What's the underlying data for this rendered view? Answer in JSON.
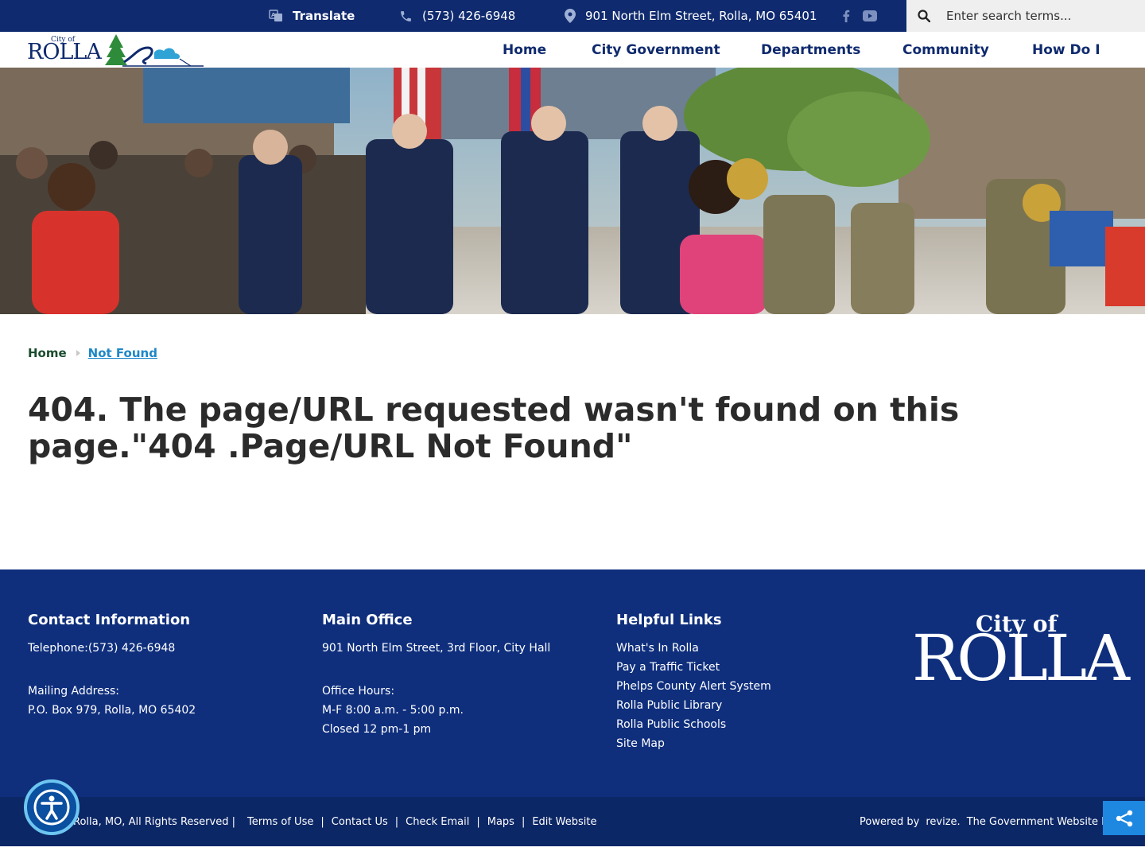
{
  "topbar": {
    "translate_label": "Translate",
    "phone": "(573) 426-6948",
    "address": "901 North Elm Street, Rolla, MO 65401",
    "search_placeholder": "Enter search terms..."
  },
  "logo": {
    "city_of": "City of",
    "name": "ROLLA"
  },
  "nav": {
    "items": [
      {
        "label": "Home"
      },
      {
        "label": "City Government"
      },
      {
        "label": "Departments"
      },
      {
        "label": "Community"
      },
      {
        "label": "How Do I"
      }
    ]
  },
  "breadcrumb": {
    "home": "Home",
    "current": "Not Found"
  },
  "main": {
    "title": "404. The page/URL requested wasn't found on this page.\"404 .Page/URL Not Found\""
  },
  "footer": {
    "contact": {
      "heading": "Contact Information",
      "telephone": "Telephone:(573) 426-6948",
      "mailing_label": "Mailing Address:",
      "mailing_address": "P.O. Box 979, Rolla, MO 65402"
    },
    "main_office": {
      "heading": "Main Office",
      "address": "901 North Elm Street, 3rd Floor, City Hall",
      "hours_label": "Office Hours:",
      "hours": "M-F 8:00 a.m. - 5:00 p.m.",
      "closed": "Closed 12 pm-1 pm"
    },
    "helpful_links": {
      "heading": "Helpful Links",
      "links": [
        {
          "label": "What's In Rolla"
        },
        {
          "label": "Pay a Traffic Ticket"
        },
        {
          "label": "Phelps County Alert System"
        },
        {
          "label": "Rolla Public Library"
        },
        {
          "label": "Rolla Public Schools"
        },
        {
          "label": "Site Map"
        }
      ]
    },
    "logo": {
      "city_of": "City of",
      "name": "ROLLA"
    }
  },
  "bottombar": {
    "copyright": "Rolla, MO, All Rights Reserved |",
    "links": [
      {
        "label": "Terms of Use"
      },
      {
        "label": "Contact Us"
      },
      {
        "label": "Check Email"
      },
      {
        "label": "Maps"
      },
      {
        "label": "Edit Website"
      }
    ],
    "powered_by": "Powered by",
    "revize": "revize.",
    "tagline": "The Government Website Experts"
  },
  "icons": {
    "translate": "translate-icon",
    "phone": "phone-icon",
    "location": "location-pin-icon",
    "facebook": "facebook-icon",
    "youtube": "youtube-icon",
    "search": "search-icon",
    "accessibility": "accessibility-icon",
    "share": "share-icon"
  },
  "colors": {
    "navy": "#0f2a6e",
    "footer_blue": "#0f2f7d",
    "link_blue": "#1e87c8",
    "breadcrumb_green": "#1a4c2e",
    "logo_green": "#2e8b3a"
  }
}
